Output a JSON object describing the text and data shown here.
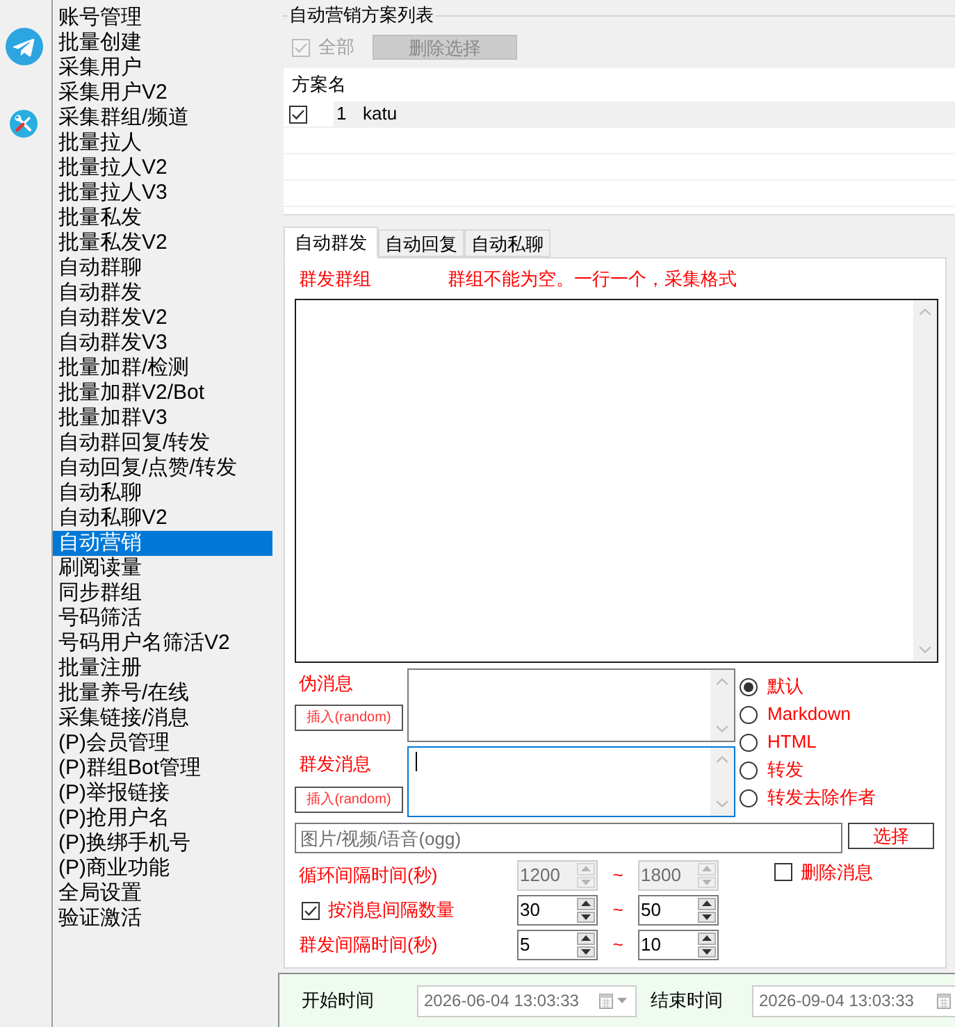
{
  "sidebar": {
    "items": [
      {
        "label": "账号管理",
        "selected": false
      },
      {
        "label": "批量创建",
        "selected": false
      },
      {
        "label": "采集用户",
        "selected": false
      },
      {
        "label": "采集用户V2",
        "selected": false
      },
      {
        "label": "采集群组/频道",
        "selected": false
      },
      {
        "label": "批量拉人",
        "selected": false
      },
      {
        "label": "批量拉人V2",
        "selected": false
      },
      {
        "label": "批量拉人V3",
        "selected": false
      },
      {
        "label": "批量私发",
        "selected": false
      },
      {
        "label": "批量私发V2",
        "selected": false
      },
      {
        "label": "自动群聊",
        "selected": false
      },
      {
        "label": "自动群发",
        "selected": false
      },
      {
        "label": "自动群发V2",
        "selected": false
      },
      {
        "label": "自动群发V3",
        "selected": false
      },
      {
        "label": "批量加群/检测",
        "selected": false
      },
      {
        "label": "批量加群V2/Bot",
        "selected": false
      },
      {
        "label": "批量加群V3",
        "selected": false
      },
      {
        "label": "自动群回复/转发",
        "selected": false
      },
      {
        "label": "自动回复/点赞/转发",
        "selected": false
      },
      {
        "label": "自动私聊",
        "selected": false
      },
      {
        "label": "自动私聊V2",
        "selected": false
      },
      {
        "label": "自动营销",
        "selected": true
      },
      {
        "label": "刷阅读量",
        "selected": false
      },
      {
        "label": "同步群组",
        "selected": false
      },
      {
        "label": "号码筛活",
        "selected": false
      },
      {
        "label": "号码用户名筛活V2",
        "selected": false
      },
      {
        "label": "批量注册",
        "selected": false
      },
      {
        "label": "批量养号/在线",
        "selected": false
      },
      {
        "label": "采集链接/消息",
        "selected": false
      },
      {
        "label": "(P)会员管理",
        "selected": false
      },
      {
        "label": "(P)群组Bot管理",
        "selected": false
      },
      {
        "label": "(P)举报链接",
        "selected": false
      },
      {
        "label": "(P)抢用户名",
        "selected": false
      },
      {
        "label": "(P)换绑手机号",
        "selected": false
      },
      {
        "label": "(P)商业功能",
        "selected": false
      },
      {
        "label": "全局设置",
        "selected": false
      },
      {
        "label": "验证激活",
        "selected": false
      }
    ]
  },
  "scheme_list": {
    "title": "自动营销方案列表",
    "select_all": {
      "label": "全部",
      "checked": true,
      "disabled": true
    },
    "delete_button": {
      "label": "删除选择",
      "disabled": true
    },
    "columns": [
      "方案名"
    ],
    "rows": [
      {
        "checked": true,
        "selected": true,
        "number": "1",
        "name": "katu"
      }
    ]
  },
  "tabs": [
    {
      "label": "自动群发",
      "selected": true
    },
    {
      "label": "自动回复",
      "selected": false
    },
    {
      "label": "自动私聊",
      "selected": false
    }
  ],
  "group_send": {
    "groups": {
      "label": "群发群组",
      "hint": "群组不能为空。一行一个，采集格式"
    },
    "fake_message": {
      "label": "伪消息",
      "insert_button": "插入(random)",
      "focused": false
    },
    "message": {
      "label": "群发消息",
      "insert_button": "插入(random)",
      "focused": true
    },
    "format_options": [
      {
        "label": "默认",
        "selected": true
      },
      {
        "label": "Markdown",
        "selected": false
      },
      {
        "label": "HTML",
        "selected": false
      },
      {
        "label": "转发",
        "selected": false
      },
      {
        "label": "转发去除作者",
        "selected": false
      }
    ],
    "media_field": {
      "placeholder": "图片/视频/语音(ogg)"
    },
    "choose_button": "选择",
    "intervals": [
      {
        "kind": "label",
        "label": "循环间隔时间(秒)",
        "min": "1200",
        "separator": "~",
        "max": "1800",
        "disabled": true
      },
      {
        "kind": "checkbox",
        "label": "按消息间隔数量",
        "checked": true,
        "min": "30",
        "separator": "~",
        "max": "50",
        "disabled": false
      },
      {
        "kind": "label",
        "label": "群发间隔时间(秒)",
        "min": "5",
        "separator": "~",
        "max": "10",
        "disabled": false
      }
    ],
    "delete_message": {
      "label": "删除消息",
      "checked": false
    }
  },
  "schedule": {
    "start_label": "开始时间",
    "start_value": "2026-06-04 13:03:33",
    "end_label": "结束时间",
    "end_value": "2026-09-04 13:03:33"
  }
}
